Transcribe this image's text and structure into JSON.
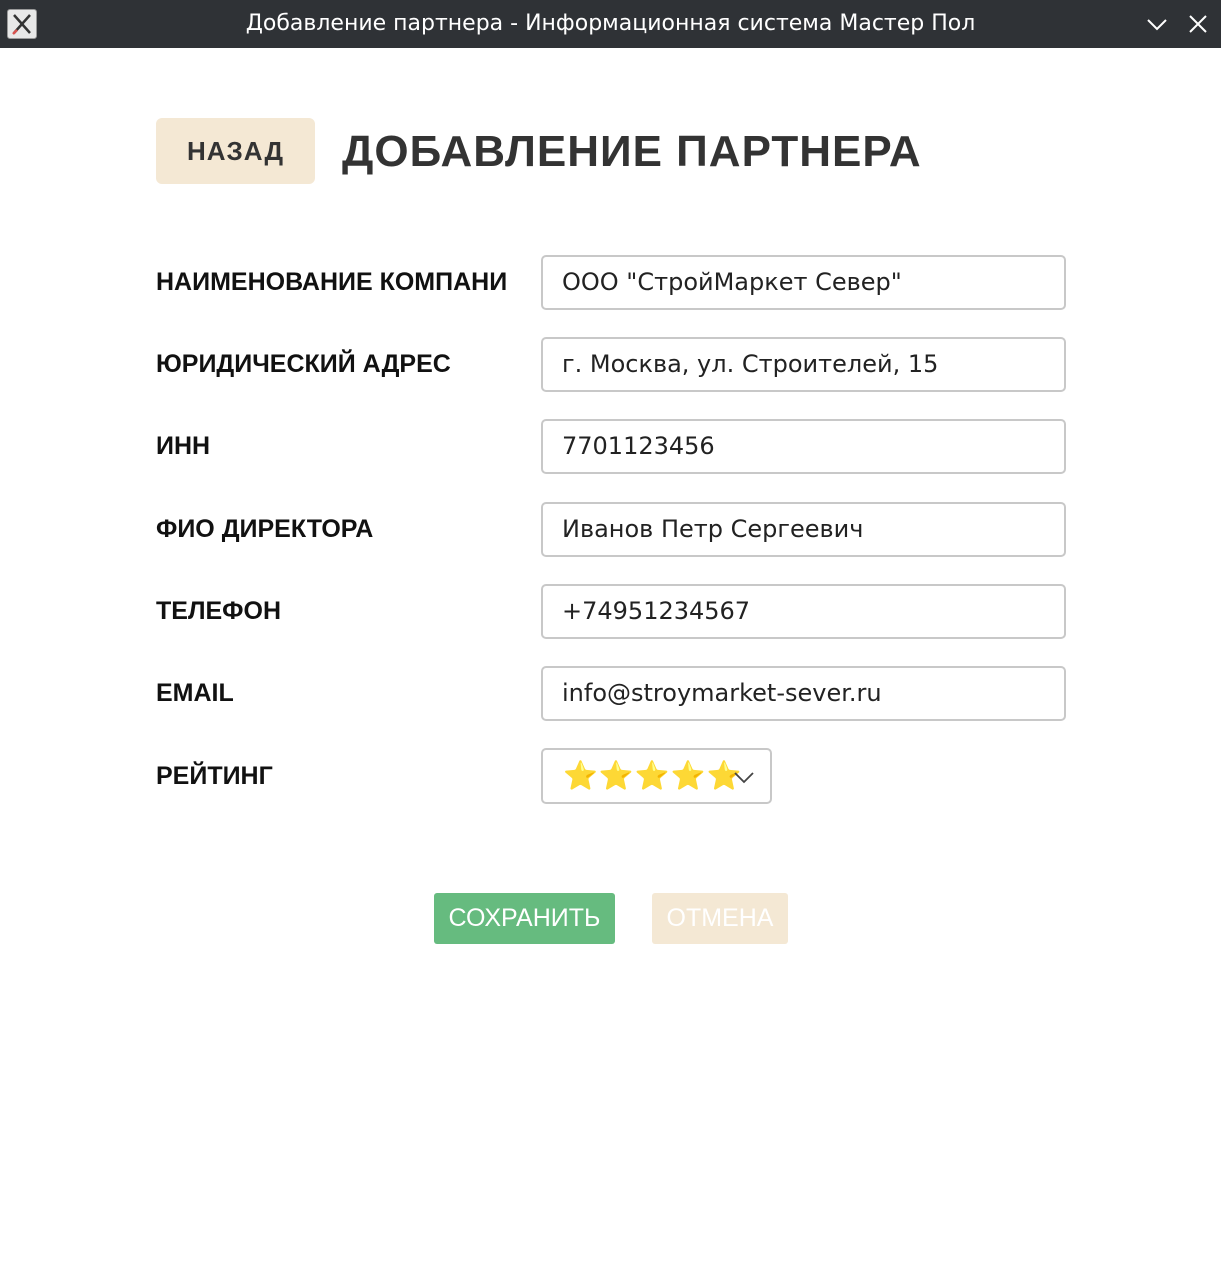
{
  "window": {
    "title": "Добавление партнера - Информационная система Мастер Пол",
    "app_icon": "x-app-icon",
    "minimize_icon": "chevron-down-icon",
    "close_icon": "close-icon"
  },
  "header": {
    "back_label": "НАЗАД",
    "page_title": "ДОБАВЛЕНИЕ ПАРТНЕРА"
  },
  "form": {
    "fields": [
      {
        "label": "НАИМЕНОВАНИЕ КОМПАНИ",
        "value": "ООО \"СтройМаркет Север\""
      },
      {
        "label": "ЮРИДИЧЕСКИЙ АДРЕС",
        "value": "г. Москва, ул. Строителей, 15"
      },
      {
        "label": "ИНН",
        "value": "7701123456"
      },
      {
        "label": "ФИО ДИРЕКТОРА",
        "value": "Иванов Петр Сергеевич"
      },
      {
        "label": "ТЕЛЕФОН",
        "value": "+74951234567"
      },
      {
        "label": "EMAIL",
        "value": "info@stroymarket-sever.ru"
      }
    ],
    "rating": {
      "label": "РЕЙТИНГ",
      "selected": "⭐⭐⭐⭐⭐",
      "stars": 5
    }
  },
  "actions": {
    "save_label": "СОХРАНИТЬ",
    "cancel_label": "ОТМЕНА"
  },
  "colors": {
    "titlebar": "#2f3236",
    "back_button": "#f4e8d4",
    "save_button": "#66bb7f",
    "cancel_button": "#f4e8d4",
    "star": "#f7c325"
  }
}
